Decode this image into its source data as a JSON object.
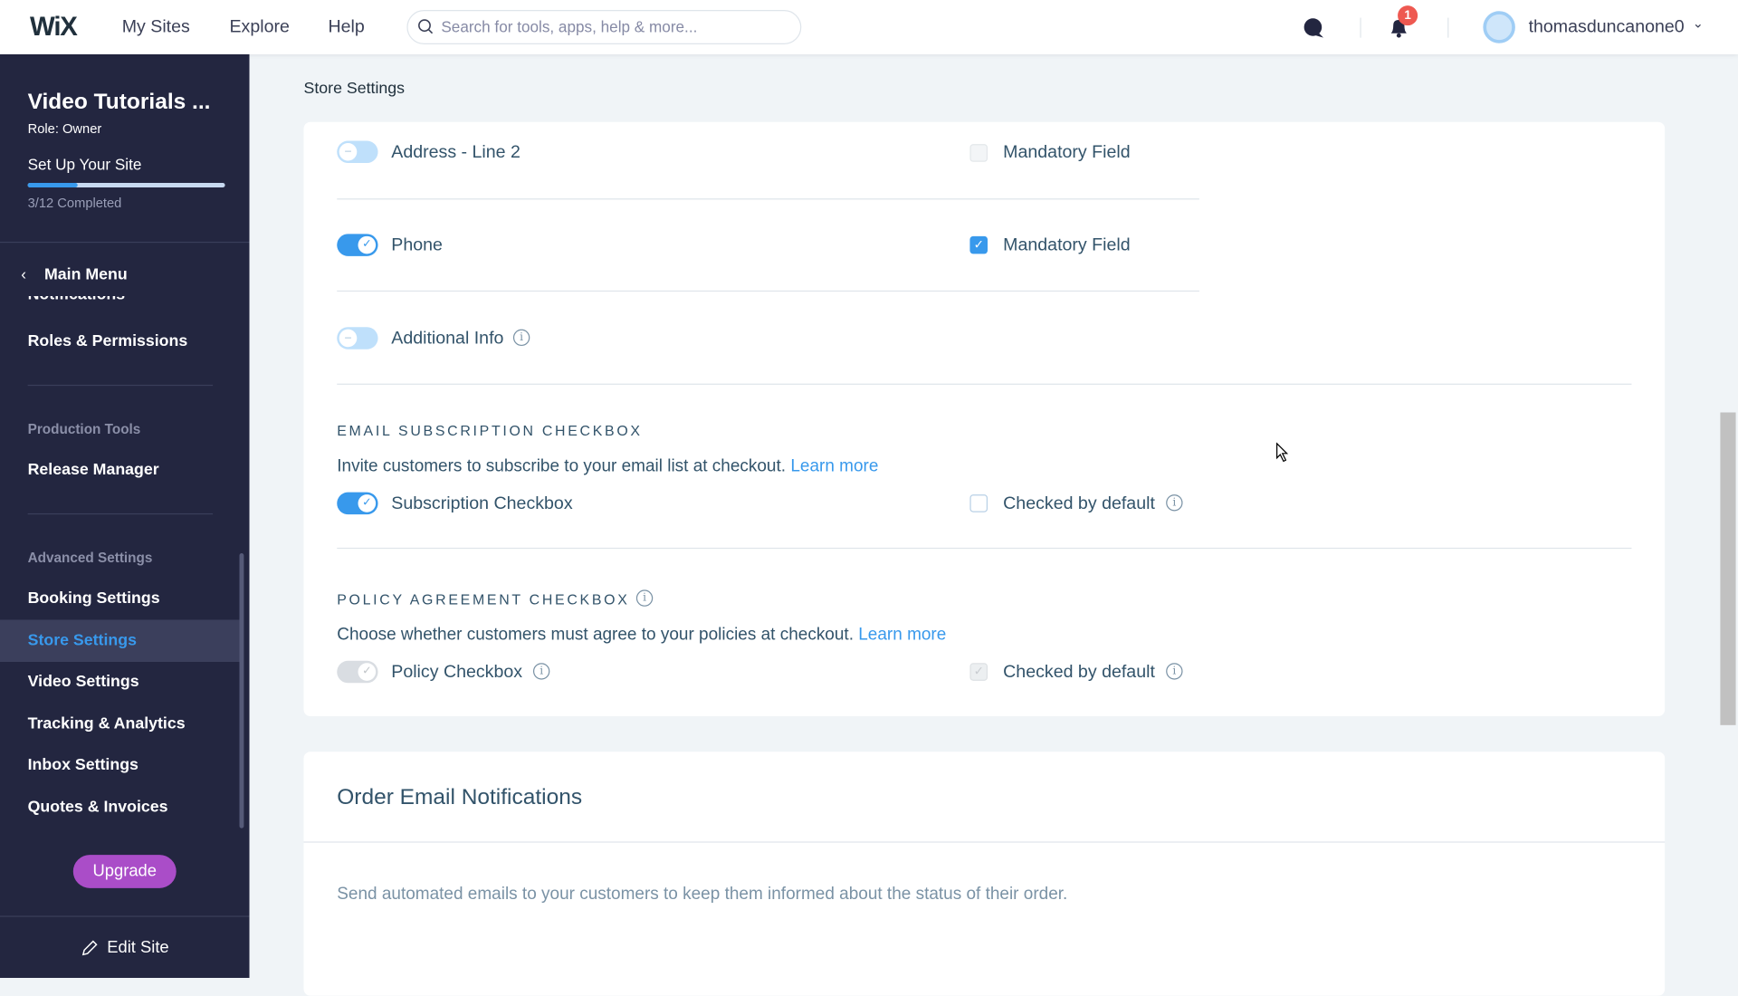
{
  "topbar": {
    "logo": "WiX",
    "nav": [
      "My Sites",
      "Explore",
      "Help"
    ],
    "search_placeholder": "Search for tools, apps, help & more...",
    "notification_count": "1",
    "username": "thomasduncanone0"
  },
  "sidebar": {
    "site_title": "Video Tutorials ...",
    "role": "Role: Owner",
    "setup_label": "Set Up Your Site",
    "setup_progress": 0.25,
    "setup_status": "3/12 Completed",
    "main_menu": "Main Menu",
    "partial_item": "Notifications",
    "roles": "Roles & Permissions",
    "section_production": "Production Tools",
    "release_manager": "Release Manager",
    "section_advanced": "Advanced Settings",
    "items": [
      "Booking Settings",
      "Store Settings",
      "Video Settings",
      "Tracking & Analytics",
      "Inbox Settings",
      "Quotes & Invoices"
    ],
    "active_item": "Store Settings",
    "upgrade": "Upgrade",
    "edit_site": "Edit Site"
  },
  "main": {
    "breadcrumb": "Store Settings",
    "fields": [
      {
        "label": "Address - Line 2",
        "enabled": false,
        "mandatory_label": "Mandatory Field",
        "mandatory": false
      },
      {
        "label": "Phone",
        "enabled": true,
        "mandatory_label": "Mandatory Field",
        "mandatory": true
      },
      {
        "label": "Additional Info",
        "enabled": false
      }
    ],
    "email_sub": {
      "heading": "EMAIL SUBSCRIPTION CHECKBOX",
      "desc": "Invite customers to subscribe to your email list at checkout.",
      "link": "Learn more",
      "toggle_label": "Subscription Checkbox",
      "toggle_on": true,
      "default_label": "Checked by default",
      "default_checked": false
    },
    "policy": {
      "heading": "POLICY AGREEMENT CHECKBOX",
      "desc": "Choose whether customers must agree to your policies at checkout.",
      "link": "Learn more",
      "toggle_label": "Policy Checkbox",
      "toggle_on": true,
      "disabled": true,
      "default_label": "Checked by default",
      "default_checked": true
    },
    "order_email": {
      "title": "Order Email Notifications",
      "desc": "Send automated emails to your customers to keep them informed about the status of their order."
    }
  },
  "colors": {
    "accent": "#3899ec",
    "sidebar_bg": "#232640",
    "upgrade": "#aa4dc8",
    "badge": "#ee5951"
  }
}
